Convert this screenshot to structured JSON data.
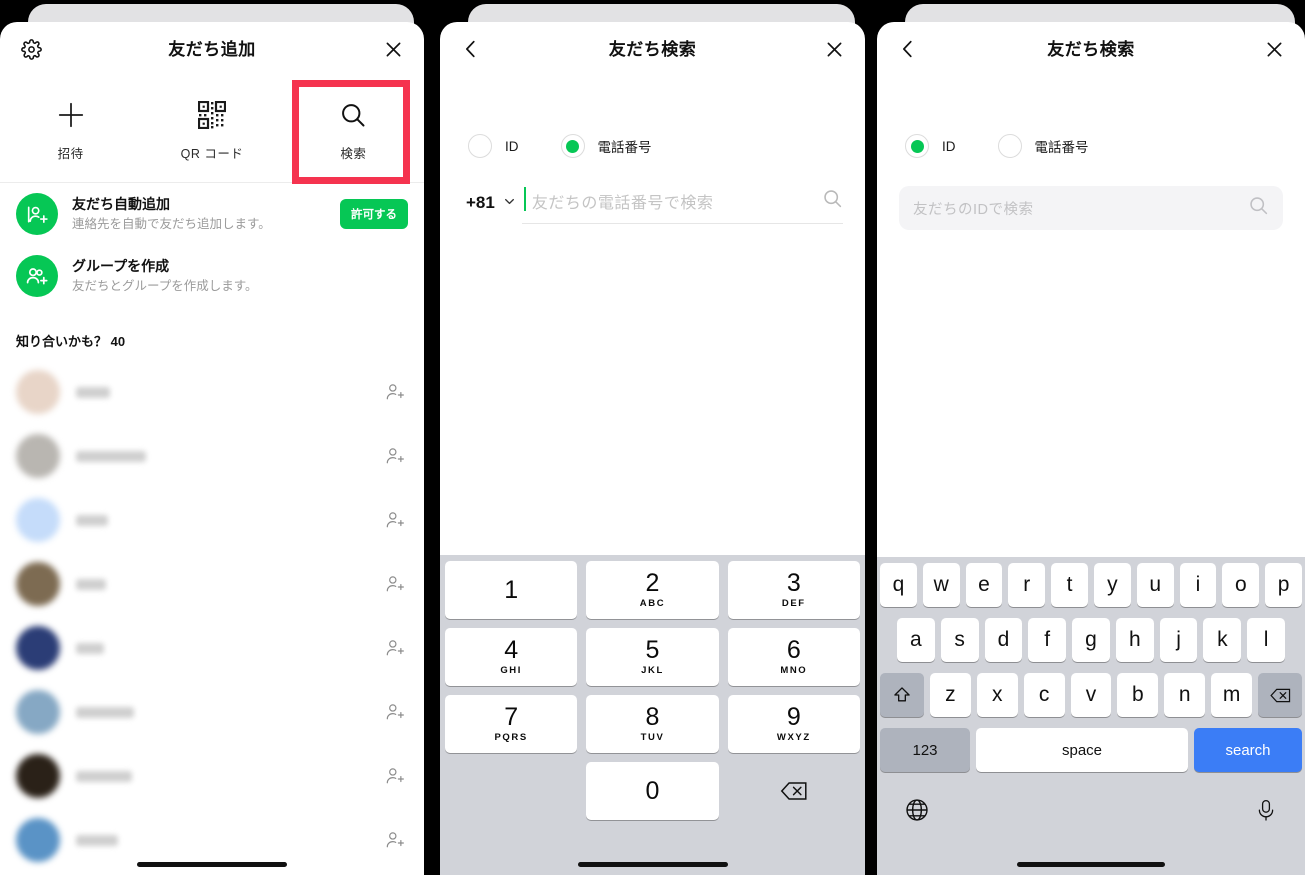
{
  "panels": [
    {
      "id": "add-friend",
      "header": {
        "title": "友だち追加",
        "left_icon": "gear-icon",
        "right_icon": "close-icon"
      },
      "tabs": [
        {
          "label": "招待",
          "icon": "plus-icon",
          "highlighted": false
        },
        {
          "label": "QR コード",
          "icon": "qr-code-icon",
          "highlighted": false
        },
        {
          "label": "検索",
          "icon": "search-icon",
          "highlighted": true
        }
      ],
      "highlight_color": "#f5334f",
      "actions": [
        {
          "title": "友だち自動追加",
          "subtitle": "連絡先を自動で友だち追加します。",
          "icon": "auto-add-friend-icon",
          "button": "許可する"
        },
        {
          "title": "グループを作成",
          "subtitle": "友だちとグループを作成します。",
          "icon": "create-group-icon",
          "button": null
        }
      ],
      "section_header": "知り合いかも？ 40",
      "contacts": [
        {
          "name": "",
          "avatar_color": "#e8d5c8",
          "name_width": 34
        },
        {
          "name": "",
          "avatar_color": "#b9b6b1",
          "name_width": 70
        },
        {
          "name": "",
          "avatar_color": "#c5dcfa",
          "name_width": 32
        },
        {
          "name": "",
          "avatar_color": "#7d6b52",
          "name_width": 30
        },
        {
          "name": "",
          "avatar_color": "#2b3d76",
          "name_width": 28
        },
        {
          "name": "",
          "avatar_color": "#86a8c4",
          "name_width": 58
        },
        {
          "name": "",
          "avatar_color": "#2a2118",
          "name_width": 56
        },
        {
          "name": "",
          "avatar_color": "#5a93c6",
          "name_width": 42
        }
      ]
    },
    {
      "id": "search-by-phone",
      "header": {
        "title": "友だち検索",
        "left_icon": "back-chevron-icon",
        "right_icon": "close-icon"
      },
      "radios": [
        {
          "label": "ID",
          "selected": false
        },
        {
          "label": "電話番号",
          "selected": true
        }
      ],
      "country_code": "+81",
      "country_code_icon": "chevron-down-icon",
      "input_placeholder": "友だちの電話番号で検索",
      "input_value": "",
      "search_icon": "search-icon",
      "caret_color": "#06c755",
      "keyboard": {
        "type": "numeric",
        "keys": [
          {
            "digit": "1",
            "letters": ""
          },
          {
            "digit": "2",
            "letters": "ABC"
          },
          {
            "digit": "3",
            "letters": "DEF"
          },
          {
            "digit": "4",
            "letters": "GHI"
          },
          {
            "digit": "5",
            "letters": "JKL"
          },
          {
            "digit": "6",
            "letters": "MNO"
          },
          {
            "digit": "7",
            "letters": "PQRS"
          },
          {
            "digit": "8",
            "letters": "TUV"
          },
          {
            "digit": "9",
            "letters": "WXYZ"
          },
          {
            "digit": "0",
            "letters": ""
          }
        ],
        "delete_icon": "backspace-icon"
      }
    },
    {
      "id": "search-by-id",
      "header": {
        "title": "友だち検索",
        "left_icon": "back-chevron-icon",
        "right_icon": "close-icon"
      },
      "radios": [
        {
          "label": "ID",
          "selected": true
        },
        {
          "label": "電話番号",
          "selected": false
        }
      ],
      "input_placeholder": "友だちのIDで検索",
      "input_value": "",
      "search_icon": "search-icon",
      "keyboard": {
        "type": "qwerty",
        "row1": [
          "q",
          "w",
          "e",
          "r",
          "t",
          "y",
          "u",
          "i",
          "o",
          "p"
        ],
        "row2": [
          "a",
          "s",
          "d",
          "f",
          "g",
          "h",
          "j",
          "k",
          "l"
        ],
        "row3": [
          "z",
          "x",
          "c",
          "v",
          "b",
          "n",
          "m"
        ],
        "shift_icon": "shift-icon",
        "delete_icon": "backspace-icon",
        "num_key": "123",
        "space_key": "space",
        "search_key": "search",
        "globe_icon": "globe-icon",
        "mic_icon": "microphone-icon",
        "search_key_color": "#3b7df6"
      }
    }
  ],
  "colors": {
    "brand_green": "#06c755",
    "highlight_red": "#f5334f",
    "keyboard_bg": "#d1d3d9",
    "search_blue": "#3b7df6"
  }
}
